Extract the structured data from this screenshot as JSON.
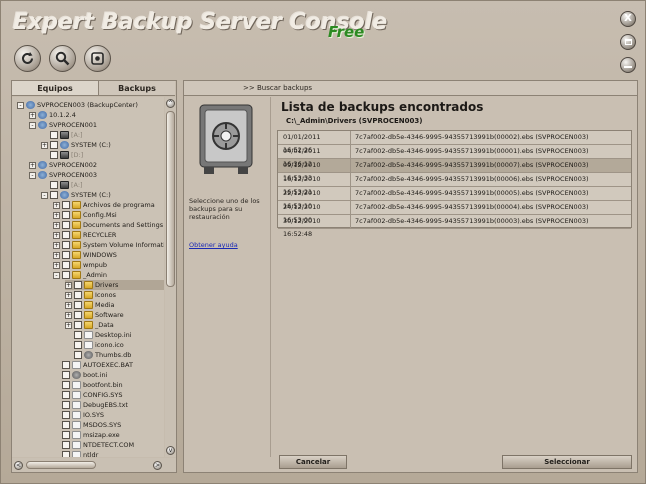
{
  "app": {
    "title": "Expert Backup Server Console",
    "edition": "Free"
  },
  "toolbar": [
    {
      "name": "refresh-icon"
    },
    {
      "name": "search-icon"
    },
    {
      "name": "settings-icon"
    }
  ],
  "window_buttons": {
    "close": "X"
  },
  "tabs": {
    "equipos": "Equipos",
    "backups": "Backups"
  },
  "tree": [
    {
      "label": "SVPROCEN003 (BackupCenter)",
      "indent": 0,
      "icon": "net",
      "pm": "-",
      "cb": false
    },
    {
      "label": "10.1.2.4",
      "indent": 1,
      "icon": "net",
      "pm": "+",
      "cb": false
    },
    {
      "label": "SVPROCEN001",
      "indent": 1,
      "icon": "net",
      "pm": "-",
      "cb": false
    },
    {
      "label": "[A:]",
      "indent": 2,
      "icon": "drive",
      "pm": "",
      "cb": true,
      "muted": true
    },
    {
      "label": "SYSTEM (C:)",
      "indent": 2,
      "icon": "net",
      "pm": "+",
      "cb": true
    },
    {
      "label": "[D:]",
      "indent": 2,
      "icon": "drive",
      "pm": "",
      "cb": true,
      "muted": true
    },
    {
      "label": "SVPROCEN002",
      "indent": 1,
      "icon": "net",
      "pm": "+",
      "cb": false
    },
    {
      "label": "SVPROCEN003",
      "indent": 1,
      "icon": "net",
      "pm": "-",
      "cb": false
    },
    {
      "label": "[A:]",
      "indent": 2,
      "icon": "drive",
      "pm": "",
      "cb": true,
      "muted": true
    },
    {
      "label": "SYSTEM (C:)",
      "indent": 2,
      "icon": "net",
      "pm": "-",
      "cb": true
    },
    {
      "label": "Archivos de programa",
      "indent": 3,
      "icon": "folder",
      "pm": "+",
      "cb": true
    },
    {
      "label": "Config.Msi",
      "indent": 3,
      "icon": "folder",
      "pm": "+",
      "cb": true
    },
    {
      "label": "Documents and Settings",
      "indent": 3,
      "icon": "folder",
      "pm": "+",
      "cb": true
    },
    {
      "label": "RECYCLER",
      "indent": 3,
      "icon": "folder",
      "pm": "+",
      "cb": true
    },
    {
      "label": "System Volume Information",
      "indent": 3,
      "icon": "folder",
      "pm": "+",
      "cb": true
    },
    {
      "label": "WINDOWS",
      "indent": 3,
      "icon": "folder",
      "pm": "+",
      "cb": true
    },
    {
      "label": "wmpub",
      "indent": 3,
      "icon": "folder",
      "pm": "+",
      "cb": true
    },
    {
      "label": "_Admin",
      "indent": 3,
      "icon": "folder",
      "pm": "-",
      "cb": true
    },
    {
      "label": "Drivers",
      "indent": 4,
      "icon": "folder",
      "pm": "+",
      "cb": true,
      "selected": true
    },
    {
      "label": "Iconos",
      "indent": 4,
      "icon": "folder",
      "pm": "+",
      "cb": true
    },
    {
      "label": "Media",
      "indent": 4,
      "icon": "folder",
      "pm": "+",
      "cb": true
    },
    {
      "label": "Software",
      "indent": 4,
      "icon": "folder",
      "pm": "+",
      "cb": true
    },
    {
      "label": "_Data",
      "indent": 4,
      "icon": "folder",
      "pm": "+",
      "cb": true
    },
    {
      "label": "Desktop.ini",
      "indent": 4,
      "icon": "file",
      "pm": "",
      "cb": true
    },
    {
      "label": "icono.ico",
      "indent": 4,
      "icon": "file",
      "pm": "",
      "cb": true
    },
    {
      "label": "Thumbs.db",
      "indent": 4,
      "icon": "gear",
      "pm": "",
      "cb": true
    },
    {
      "label": "AUTOEXEC.BAT",
      "indent": 3,
      "icon": "file",
      "pm": "",
      "cb": true
    },
    {
      "label": "boot.ini",
      "indent": 3,
      "icon": "gear",
      "pm": "",
      "cb": true
    },
    {
      "label": "bootfont.bin",
      "indent": 3,
      "icon": "file",
      "pm": "",
      "cb": true
    },
    {
      "label": "CONFIG.SYS",
      "indent": 3,
      "icon": "file",
      "pm": "",
      "cb": true
    },
    {
      "label": "DebugEBS.txt",
      "indent": 3,
      "icon": "file",
      "pm": "",
      "cb": true
    },
    {
      "label": "IO.SYS",
      "indent": 3,
      "icon": "file",
      "pm": "",
      "cb": true
    },
    {
      "label": "MSDOS.SYS",
      "indent": 3,
      "icon": "file",
      "pm": "",
      "cb": true
    },
    {
      "label": "msizap.exe",
      "indent": 3,
      "icon": "file",
      "pm": "",
      "cb": true
    },
    {
      "label": "NTDETECT.COM",
      "indent": 3,
      "icon": "file",
      "pm": "",
      "cb": true
    },
    {
      "label": "ntldr",
      "indent": 3,
      "icon": "file",
      "pm": "",
      "cb": true
    }
  ],
  "scroll": {
    "up": "^",
    "down": "v",
    "left": "<",
    "right": ">"
  },
  "right": {
    "crumb": ">> Buscar backups",
    "side_text": "Seleccione uno de los backups para su restauración",
    "side_link": "Obtener ayuda",
    "list_title": "Lista de backups encontrados",
    "path": "C:\\_Admin\\Drivers (SVPROCEN003)",
    "backups": [
      {
        "date": "01/01/2011 16:52:26",
        "name": "7c7af002-db5e-4346-9995-94355713991b(00002).ebs (SVPROCEN003)"
      },
      {
        "date": "04/01/2011 16:36:12",
        "name": "7c7af002-db5e-4346-9995-94355713991b(00001).ebs (SVPROCEN003)"
      },
      {
        "date": "09/12/2010 16:53:33",
        "name": "7c7af002-db5e-4346-9995-94355713991b(00007).ebs (SVPROCEN003)",
        "selected": true
      },
      {
        "date": "16/12/2010 16:53:21",
        "name": "7c7af002-db5e-4346-9995-94355713991b(00006).ebs (SVPROCEN003)"
      },
      {
        "date": "22/12/2010 16:53:10",
        "name": "7c7af002-db5e-4346-9995-94355713991b(00005).ebs (SVPROCEN003)"
      },
      {
        "date": "24/12/2010 16:53:00",
        "name": "7c7af002-db5e-4346-9995-94355713991b(00004).ebs (SVPROCEN003)"
      },
      {
        "date": "30/12/2010 16:52:48",
        "name": "7c7af002-db5e-4346-9995-94355713991b(00003).ebs (SVPROCEN003)"
      }
    ],
    "cancel": "Cancelar",
    "select": "Seleccionar"
  }
}
